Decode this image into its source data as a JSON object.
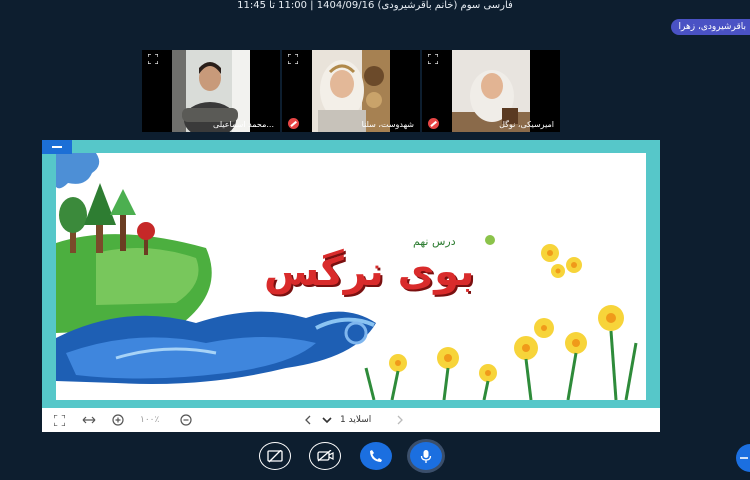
{
  "header": {
    "title": "فارسی سوم (خانم باقرشیرودی) 1404/09/16 | 11:00 تا 11:45"
  },
  "presenter": {
    "name": "باقرشیرودی، زهرا"
  },
  "participants": [
    {
      "name": "محمد اسماعیلی...",
      "muted": false
    },
    {
      "name": "شهدوست، سلنا",
      "muted": true
    },
    {
      "name": "امیرسیکی، نوگل",
      "muted": true
    }
  ],
  "slide": {
    "lesson_label": "درس نهم",
    "title": "بوی نرگس"
  },
  "slide_controls": {
    "zoom": "۱۰۰٪",
    "page": "اسلاید 1"
  },
  "colors": {
    "background": "#0d1e2f",
    "accent": "#1b6fe0",
    "frame": "#56c7c9",
    "title_red": "#d92b2b"
  },
  "icons": [
    "expand-icon",
    "mic-muted-icon",
    "fit-screen-icon",
    "fit-width-icon",
    "zoom-in-icon",
    "zoom-out-icon",
    "chevron-left-icon",
    "chevron-right-icon",
    "chevron-down-icon",
    "screen-share-off-icon",
    "camera-off-icon",
    "phone-icon",
    "microphone-icon",
    "plus-icon"
  ]
}
